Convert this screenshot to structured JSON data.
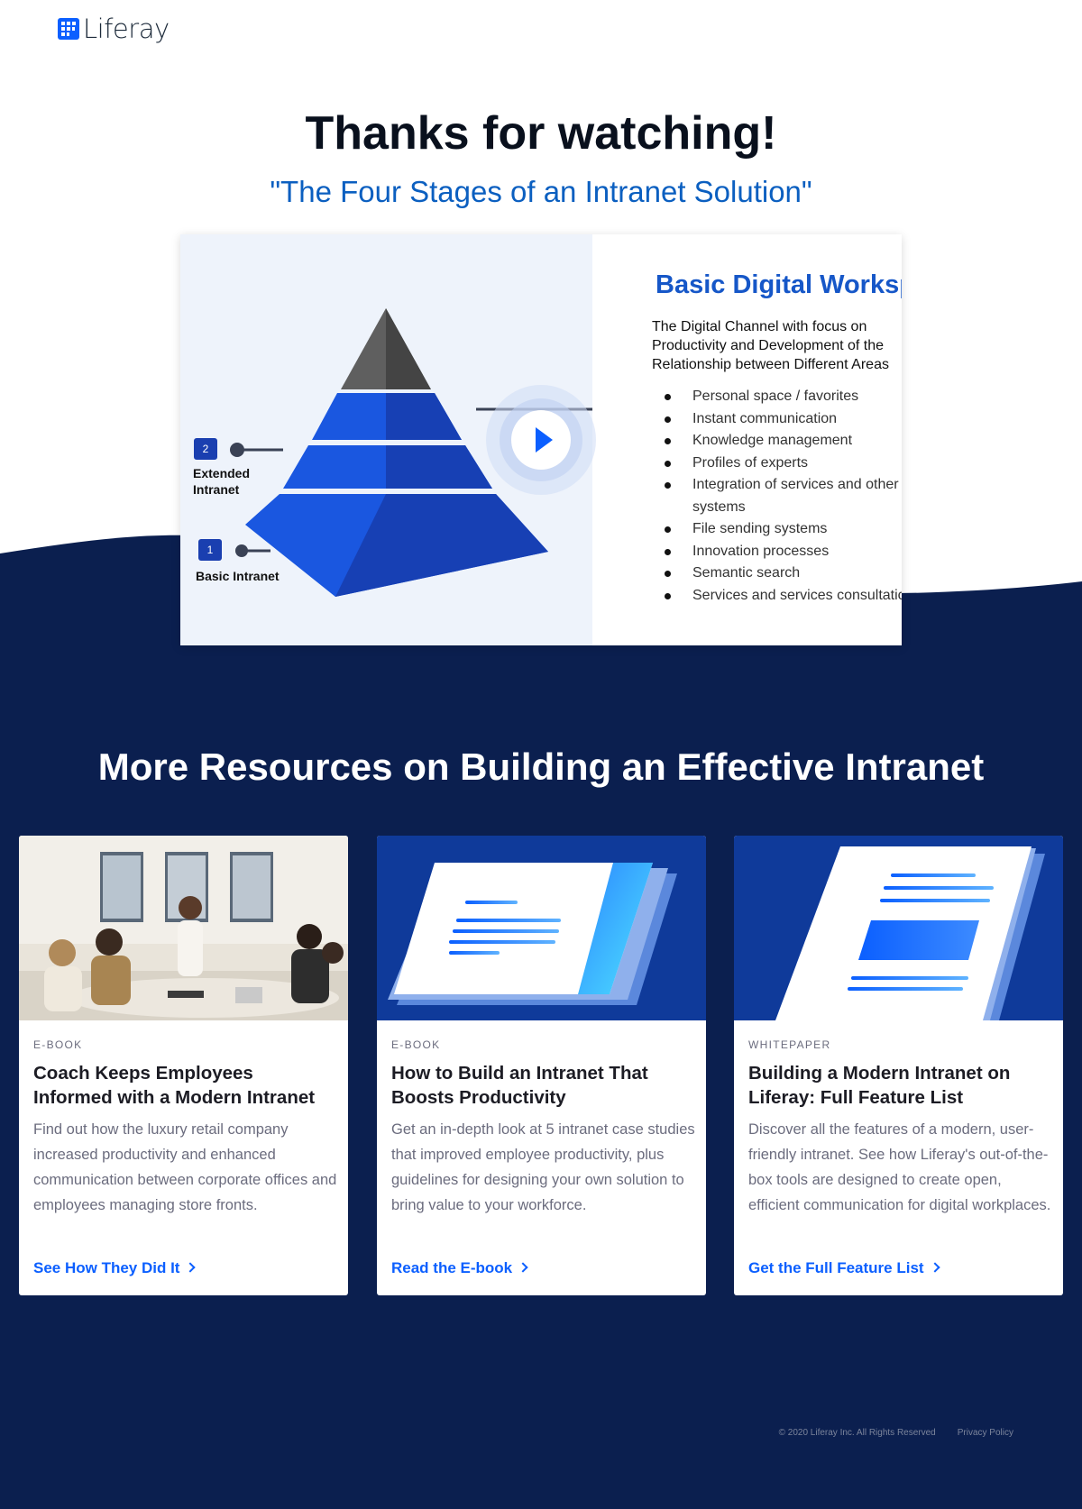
{
  "header": {
    "logo_text": "Liferay"
  },
  "hero": {
    "title": "Thanks for watching!",
    "subtitle": "\"The Four Stages of an Intranet Solution\""
  },
  "video": {
    "slide_heading": "Basic Digital Workspa",
    "slide_description": "The Digital Channel with focus on Productivity and Development of the Relationship between Different Areas",
    "slide_list": [
      "Personal space / favorites",
      "Instant communication",
      "Knowledge management",
      "Profiles of experts",
      "Integration of services and other systems",
      "File sending systems",
      "Innovation processes",
      "Semantic search",
      "Services and services consultatic"
    ],
    "levels": [
      {
        "number": "2",
        "label": "Extended Intranet"
      },
      {
        "number": "1",
        "label": "Basic Intranet"
      }
    ],
    "play_icon": "play-icon"
  },
  "resources": {
    "title": "More Resources on Building an Effective Intranet",
    "cards": [
      {
        "type": "E-BOOK",
        "title": "Coach Keeps Employees Informed with a Modern Intranet",
        "description": "Find out how the luxury retail company increased productivity and enhanced communication between corporate offices and employees managing store fronts.",
        "link": "See How They Did It"
      },
      {
        "type": "E-BOOK",
        "title": "How to Build an Intranet That Boosts Productivity",
        "description": "Get an in-depth look at 5 intranet case studies that improved employee productivity, plus guidelines for designing your own solution to bring value to your workforce.",
        "link": "Read the E-book"
      },
      {
        "type": "WHITEPAPER",
        "title": "Building a Modern Intranet on Liferay: Full Feature List",
        "description": "Discover all the features of a modern, user-friendly intranet. See how Liferay's out-of-the-box tools are designed to create open, efficient communication for digital workplaces.",
        "link": "Get the Full Feature List"
      }
    ]
  },
  "footer": {
    "copyright": "© 2020 Liferay Inc. All Rights Reserved",
    "privacy": "Privacy Policy"
  },
  "colors": {
    "navy": "#0b1f4f",
    "brand_blue": "#0b5fff",
    "subtitle_blue": "#0b5fc0"
  }
}
